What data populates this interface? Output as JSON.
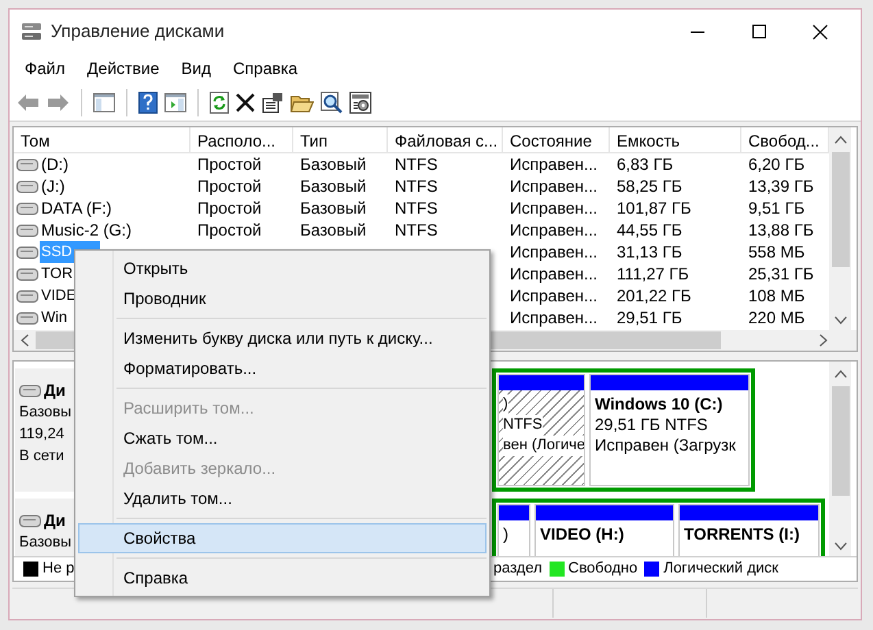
{
  "window": {
    "title": "Управление дисками"
  },
  "menu": [
    "Файл",
    "Действие",
    "Вид",
    "Справка"
  ],
  "table": {
    "columns": [
      "Том",
      "Располо...",
      "Тип",
      "Файловая с...",
      "Состояние",
      "Емкость",
      "Свобод..."
    ],
    "rows": [
      {
        "volume": "(D:)",
        "layout": "Простой",
        "type": "Базовый",
        "fs": "NTFS",
        "status": "Исправен...",
        "capacity": "6,83 ГБ",
        "free": "6,20 ГБ",
        "selected": false
      },
      {
        "volume": "(J:)",
        "layout": "Простой",
        "type": "Базовый",
        "fs": "NTFS",
        "status": "Исправен...",
        "capacity": "58,25 ГБ",
        "free": "13,39 ГБ",
        "selected": false
      },
      {
        "volume": "DATA (F:)",
        "layout": "Простой",
        "type": "Базовый",
        "fs": "NTFS",
        "status": "Исправен...",
        "capacity": "101,87 ГБ",
        "free": "9,51 ГБ",
        "selected": false
      },
      {
        "volume": "Music-2 (G:)",
        "layout": "Простой",
        "type": "Базовый",
        "fs": "NTFS",
        "status": "Исправен...",
        "capacity": "44,55 ГБ",
        "free": "13,88 ГБ",
        "selected": false
      },
      {
        "volume": "SSD",
        "status": "Исправен...",
        "capacity": "31,13 ГБ",
        "free": "558 МБ",
        "selected": true
      },
      {
        "volume": "TOR",
        "status": "Исправен...",
        "capacity": "111,27 ГБ",
        "free": "25,31 ГБ",
        "selected": false
      },
      {
        "volume": "VIDE",
        "status": "Исправен...",
        "capacity": "201,22 ГБ",
        "free": "108 МБ",
        "selected": false
      },
      {
        "volume": "Win",
        "status": "Исправен...",
        "capacity": "29,51 ГБ",
        "free": "220 МБ",
        "selected": false
      }
    ]
  },
  "disks": [
    {
      "name": "Ди",
      "lines": [
        "Базовы",
        "119,24",
        "В сети"
      ],
      "partitions": [
        {
          "kind": "hatched",
          "lines": [
            ")",
            "NTFS",
            "вен (Логиче"
          ]
        },
        {
          "kind": "plain",
          "title": "Windows 10  (C:)",
          "lines": [
            "29,51 ГБ NTFS",
            "Исправен (Загрузк"
          ]
        }
      ]
    },
    {
      "name": "Ди",
      "lines": [
        "Базовы"
      ],
      "partitions": [
        {
          "kind": "plain",
          "lines": [
            ")"
          ]
        },
        {
          "kind": "plain",
          "title": "VIDEO  (H:)"
        },
        {
          "kind": "plain",
          "title": "TORRENTS  (I:)"
        }
      ]
    }
  ],
  "legend": [
    {
      "label": "Не р",
      "color": "#000000"
    },
    {
      "label": "раздел"
    },
    {
      "label": "Свободно",
      "color": "#22e622"
    },
    {
      "label": "Логический диск",
      "color": "#0000ff"
    }
  ],
  "context_menu": [
    {
      "kind": "item",
      "label": "Открыть",
      "disabled": false,
      "selected": false
    },
    {
      "kind": "item",
      "label": "Проводник",
      "disabled": false,
      "selected": false
    },
    {
      "kind": "separator"
    },
    {
      "kind": "item",
      "label": "Изменить букву диска или путь к диску...",
      "disabled": false,
      "selected": false
    },
    {
      "kind": "item",
      "label": "Форматировать...",
      "disabled": false,
      "selected": false
    },
    {
      "kind": "separator"
    },
    {
      "kind": "item",
      "label": "Расширить том...",
      "disabled": true,
      "selected": false
    },
    {
      "kind": "item",
      "label": "Сжать том...",
      "disabled": false,
      "selected": false
    },
    {
      "kind": "item",
      "label": "Добавить зеркало...",
      "disabled": true,
      "selected": false
    },
    {
      "kind": "item",
      "label": "Удалить том...",
      "disabled": false,
      "selected": false
    },
    {
      "kind": "separator"
    },
    {
      "kind": "item",
      "label": "Свойства",
      "disabled": false,
      "selected": true
    },
    {
      "kind": "separator"
    },
    {
      "kind": "item",
      "label": "Справка",
      "disabled": false,
      "selected": false
    }
  ]
}
